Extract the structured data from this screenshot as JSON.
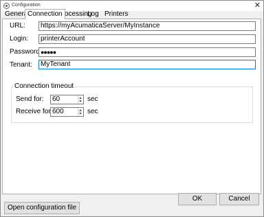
{
  "window": {
    "title": "Configuration",
    "close_glyph": "✕"
  },
  "tabs": [
    {
      "label": "General"
    },
    {
      "label": "Connection",
      "active": true
    },
    {
      "label": "Processing"
    },
    {
      "label": "Log"
    },
    {
      "label": "Printers"
    }
  ],
  "connection": {
    "url": {
      "label": "URL:",
      "value": "https://myAcumaticaServer/MyInstance"
    },
    "login": {
      "label": "Login:",
      "value": "printerAccount"
    },
    "password": {
      "label": "Password:",
      "value": "●●●●●"
    },
    "tenant": {
      "label": "Tenant:",
      "value": "MyTenant"
    }
  },
  "timeout": {
    "title": "Connection timeout",
    "send": {
      "label": "Send for:",
      "value": "60",
      "unit": "sec"
    },
    "receive": {
      "label": "Receive for:",
      "value": "600",
      "unit": "sec"
    }
  },
  "buttons": {
    "ok": "OK",
    "cancel": "Cancel",
    "open_config": "Open configuration file"
  },
  "colors": {
    "focus_border": "#0078d7",
    "panel": "#ffffff",
    "chrome": "#f0f0f0"
  }
}
